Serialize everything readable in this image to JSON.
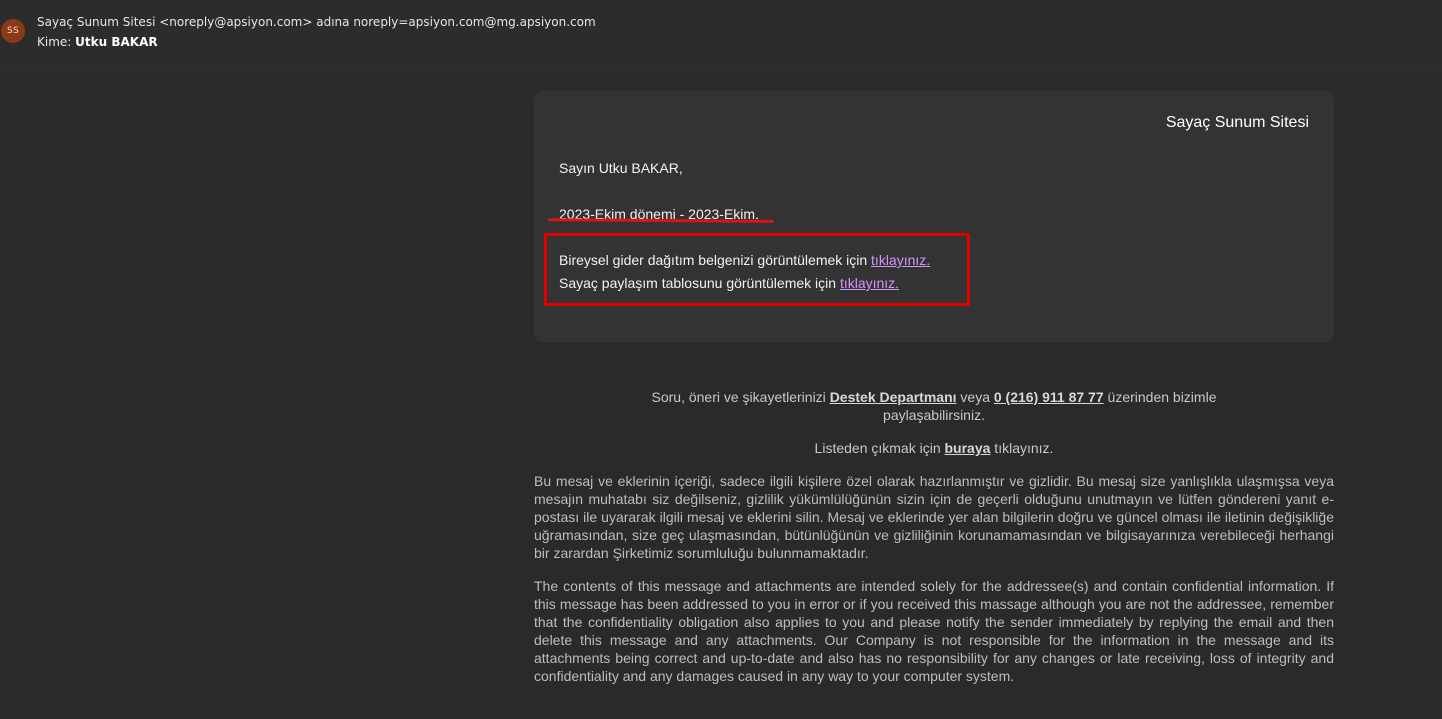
{
  "header": {
    "avatar_initials": "SS",
    "sender_text": "Sayaç Sunum Sitesi <noreply@apsiyon.com> adına noreply=apsiyon.com@mg.apsiyon.com",
    "to_label": "Kime:",
    "to_name": "Utku BAKAR"
  },
  "card": {
    "brand": "Sayaç Sunum Sitesi",
    "greeting": "Sayın Utku BAKAR,",
    "period": "2023-Ekim dönemi - 2023-Ekim.",
    "line1_text": "Bireysel gider dağıtım belgenizi görüntülemek için ",
    "line1_link": "tıklayınız.",
    "line2_text": "Sayaç paylaşım tablosunu görüntülemek için ",
    "line2_link": "tıklayınız."
  },
  "footer": {
    "support_prefix": "Soru, öneri ve şikayetlerinizi ",
    "support_link": "Destek Departmanı",
    "support_mid": " veya ",
    "support_phone": "0 (216) 911 87 77",
    "support_suffix": " üzerinden bizimle paylaşabilirsiniz.",
    "unsub_prefix": "Listeden çıkmak için ",
    "unsub_link": "buraya",
    "unsub_suffix": " tıklayınız.",
    "disclaimer_tr": "Bu mesaj ve eklerinin içeriği, sadece ilgili kişilere özel olarak hazırlanmıştır ve gizlidir. Bu mesaj size yanlışlıkla ulaşmışsa veya mesajın muhatabı siz değilseniz, gizlilik yükümlülüğünün sizin için de geçerli olduğunu unutmayın ve lütfen göndereni yanıt e-postası ile uyararak ilgili mesaj ve eklerini silin. Mesaj ve eklerinde yer alan bilgilerin doğru ve güncel olması ile iletinin değişikliğe uğramasından, size geç ulaşmasından, bütünlüğünün ve gizliliğinin korunamamasından ve bilgisayarınıza verebileceği herhangi bir zarardan Şirketimiz sorumluluğu bulunmamaktadır.",
    "disclaimer_en": "The contents of this message and attachments are intended solely for the addressee(s) and contain confidential information. If this message has been addressed to you in error or if you received this massage although you are not the addressee, remember that the confidentiality obligation also applies to you and please notify the sender immediately by replying the email and then delete this message and any attachments. Our Company is not responsible for the information in the message and its attachments being correct and up-to-date and also has no responsibility for any changes or late receiving, loss of integrity and confidentiality and any damages caused in any way to your computer system."
  },
  "colors": {
    "background": "#2b2b2b",
    "card": "#333333",
    "link": "#d694ff",
    "annotation_red": "#e00000",
    "avatar": "#8a3a17"
  }
}
